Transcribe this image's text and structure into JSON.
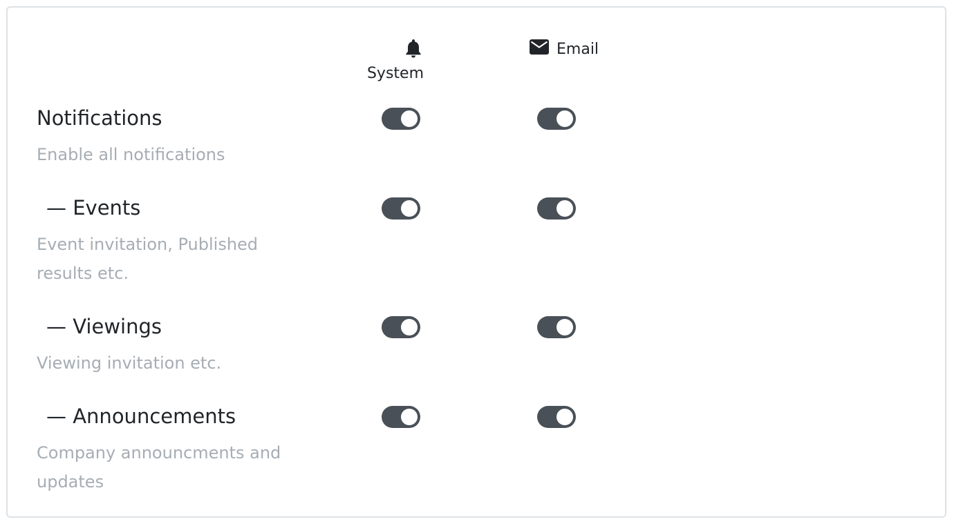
{
  "channels": [
    {
      "label": "System",
      "icon": "bell-icon"
    },
    {
      "label": "Email",
      "icon": "envelope-icon"
    }
  ],
  "rows": [
    {
      "title": "Notifications",
      "description": "Enable all notifications",
      "system_on": true,
      "email_on": true
    },
    {
      "title": "— Events",
      "description": "Event invitation, Published results etc.",
      "system_on": true,
      "email_on": true
    },
    {
      "title": "— Viewings",
      "description": "Viewing invitation etc.",
      "system_on": true,
      "email_on": true
    },
    {
      "title": "— Announcements",
      "description": "Company announcments and updates",
      "system_on": true,
      "email_on": true
    }
  ],
  "colors": {
    "toggle_on": "#495057",
    "muted_text": "#a6adb4",
    "border": "#dee2e6"
  }
}
